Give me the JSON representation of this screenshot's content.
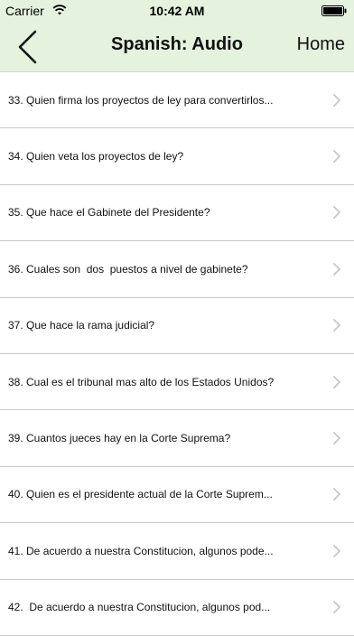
{
  "status_bar": {
    "carrier": "Carrier",
    "time": "10:42 AM"
  },
  "nav": {
    "title": "Spanish: Audio",
    "home_label": "Home",
    "back_icon": "chevron-left-icon"
  },
  "colors": {
    "header_bg": "#e4f2de",
    "chevron": "#c7c7cc"
  },
  "list": {
    "items": [
      {
        "label": "33. Quien firma los proyectos de ley para convertirlos..."
      },
      {
        "label": "34. Quien veta los proyectos de ley?"
      },
      {
        "label": "35. Que hace el Gabinete del Presidente?"
      },
      {
        "label": "36. Cuales son  dos  puestos a nivel de gabinete?"
      },
      {
        "label": "37. Que hace la rama judicial?"
      },
      {
        "label": "38. Cual es el tribunal mas alto de los Estados Unidos?"
      },
      {
        "label": "39. Cuantos jueces hay en la Corte Suprema?"
      },
      {
        "label": "40. Quien es el presidente actual de la Corte Suprem..."
      },
      {
        "label": "41. De acuerdo a nuestra Constitucion, algunos pode..."
      },
      {
        "label": "42.  De acuerdo a nuestra Constitucion, algunos pod..."
      }
    ]
  }
}
